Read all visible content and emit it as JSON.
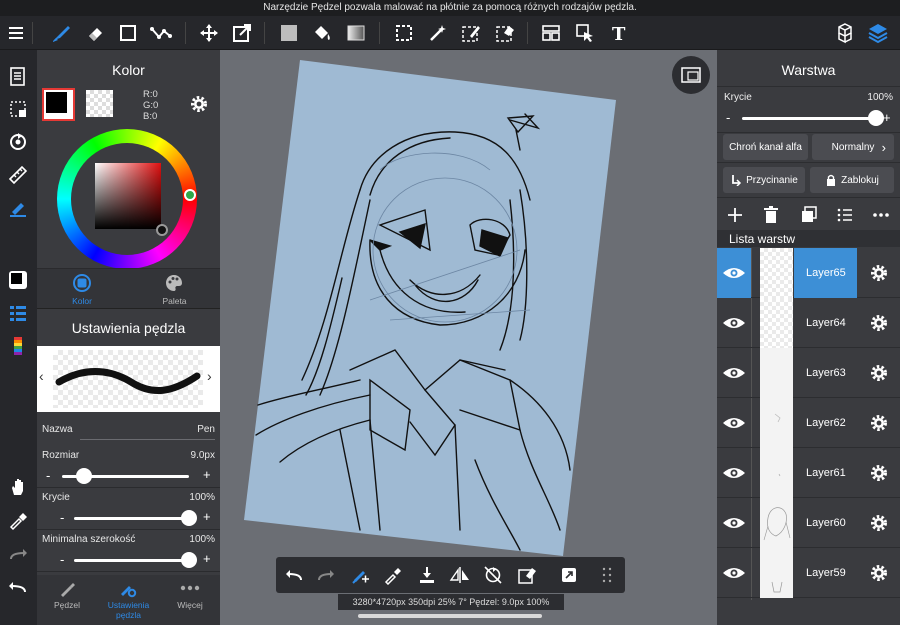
{
  "top_message": "Narzędzie Pędzel pozwala malować na płótnie za pomocą różnych rodzajów pędzla.",
  "color_panel": {
    "title": "Kolor",
    "rgb": {
      "r": "R:0",
      "g": "G:0",
      "b": "B:0"
    },
    "tabs": [
      {
        "label": "Kolor"
      },
      {
        "label": "Paleta"
      }
    ]
  },
  "brush_panel": {
    "title": "Ustawienia pędzla",
    "name_label": "Nazwa",
    "name_value": "Pen",
    "size_label": "Rozmiar",
    "size_value": "9.0px",
    "size_level": 0.17,
    "opacity_label": "Krycie",
    "opacity_value": "100%",
    "opacity_level": 1.0,
    "minwidth_label": "Minimalna szerokość",
    "minwidth_value": "100%",
    "minwidth_level": 1.0,
    "tabs": [
      {
        "label": "Pędzel"
      },
      {
        "label": "Ustawienia pędzla"
      },
      {
        "label": "Więcej"
      }
    ]
  },
  "layer_panel": {
    "title": "Warstwa",
    "opacity_label": "Krycie",
    "opacity_value": "100%",
    "opacity_level": 1.0,
    "alpha_lock_label": "Chroń kanał alfa",
    "blend_mode": "Normalny",
    "clipping_label": "Przycinanie",
    "lock_label": "Zablokuj",
    "list_title": "Lista warstw",
    "layers": [
      {
        "name": "Layer65",
        "selected": true
      },
      {
        "name": "Layer64",
        "selected": false
      },
      {
        "name": "Layer63",
        "selected": false
      },
      {
        "name": "Layer62",
        "selected": false
      },
      {
        "name": "Layer61",
        "selected": false
      },
      {
        "name": "Layer60",
        "selected": false
      },
      {
        "name": "Layer59",
        "selected": false
      }
    ]
  },
  "status": "3280*4720px 350dpi 25% 7° Pędzel: 9.0px 100%",
  "colors": {
    "accent": "#2e8ae6",
    "selected_layer": "#3d8fd6",
    "canvas_paper": "#9fbad3",
    "background": "#6b6e74"
  }
}
